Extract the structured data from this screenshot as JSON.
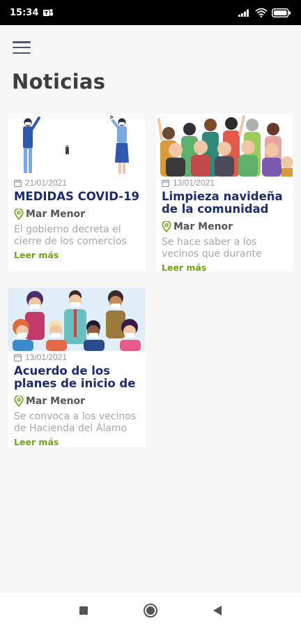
{
  "status_bar": {
    "time": "15:34",
    "icons": [
      "teams-icon",
      "signal-icon",
      "wifi-icon",
      "battery-icon"
    ]
  },
  "header": {
    "menu_icon": "hamburger-menu-icon",
    "title": "Noticias"
  },
  "news": [
    {
      "date": "21/01/2021",
      "title_lines": [
        "MEDIDAS COVID-19"
      ],
      "location": "Mar Menor",
      "excerpt_lines": [
        "El gobierno decreta el",
        "cierre de los comercios"
      ],
      "more_label": "Leer más"
    },
    {
      "date": "13/01/2021",
      "title_lines": [
        "Limpieza navideña",
        "de la comunidad"
      ],
      "location": "Mar Menor",
      "excerpt_lines": [
        "Se hace saber a los",
        "vecinos que durante"
      ],
      "more_label": "Leer más"
    },
    {
      "date": "13/01/2021",
      "title_lines": [
        "Acuerdo de los",
        "planes de inicio de"
      ],
      "location": "Mar Menor",
      "excerpt_lines": [
        "Se convoca a los vecinos",
        "de Hacienda del Álamo"
      ],
      "more_label": "Leer más"
    }
  ],
  "nav_bar": {
    "buttons": [
      "recent-apps-icon",
      "home-icon",
      "back-icon"
    ]
  },
  "colors": {
    "title": "#1d2c6b",
    "accent_green": "#6fa515",
    "menu": "#4a5680"
  }
}
